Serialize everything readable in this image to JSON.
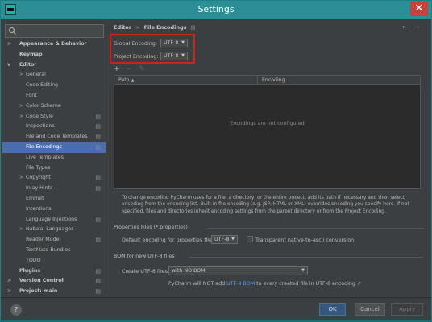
{
  "window": {
    "title": "Settings",
    "close_glyph": "✕"
  },
  "sidebar": {
    "search_placeholder": "",
    "items": [
      {
        "label": "Appearance & Behavior",
        "arrow": ">",
        "bold": true
      },
      {
        "label": "Keymap",
        "arrow": "",
        "bold": true
      },
      {
        "label": "Editor",
        "arrow": "v",
        "bold": true
      },
      {
        "label": "General",
        "arrow": ">"
      },
      {
        "label": "Code Editing"
      },
      {
        "label": "Font"
      },
      {
        "label": "Color Scheme",
        "arrow": ">"
      },
      {
        "label": "Code Style",
        "arrow": ">",
        "glyph": "▤"
      },
      {
        "label": "Inspections",
        "glyph": "▤"
      },
      {
        "label": "File and Code Templates",
        "glyph": "▤"
      },
      {
        "label": "File Encodings",
        "glyph": "▤",
        "selected": true
      },
      {
        "label": "Live Templates"
      },
      {
        "label": "File Types"
      },
      {
        "label": "Copyright",
        "arrow": ">",
        "glyph": "▤"
      },
      {
        "label": "Inlay Hints",
        "glyph": "▤"
      },
      {
        "label": "Emmet"
      },
      {
        "label": "Intentions"
      },
      {
        "label": "Language Injections",
        "glyph": "▤"
      },
      {
        "label": "Natural Languages",
        "arrow": ">"
      },
      {
        "label": "Reader Mode",
        "glyph": "▤"
      },
      {
        "label": "TextMate Bundles"
      },
      {
        "label": "TODO"
      },
      {
        "label": "Plugins",
        "bold": true,
        "glyph": "▤"
      },
      {
        "label": "Version Control",
        "arrow": ">",
        "bold": true,
        "glyph": "▤"
      },
      {
        "label": "Project: main",
        "arrow": ">",
        "bold": true,
        "glyph": "▤"
      }
    ]
  },
  "main": {
    "breadcrumb_parent": "Editor",
    "breadcrumb_sep": ">",
    "breadcrumb_current": "File Encodings",
    "breadcrumb_hint": "▤",
    "back_arrow": "←",
    "forward_arrow": "→",
    "global_encoding_label": "Global Encoding:",
    "global_encoding_value": "UTF-8",
    "project_encoding_label": "Project Encoding:",
    "project_encoding_value": "UTF-8",
    "dropdown_glyph": "▼",
    "toolbar": {
      "add": "+",
      "remove": "−",
      "edit": "✎"
    },
    "table": {
      "col_path": "Path",
      "col_path_sort": "▲",
      "col_encoding": "Encoding",
      "empty_text": "Encodings are not configured"
    },
    "description": "To change encoding PyCharm uses for a file, a directory, or the entire project, add its path if necessary and then select encoding from the encoding list. Built-in file encoding (e.g. JSP, HTML or XML) overrides encoding you specify here. If not specified, files and directories inherit encoding settings from the parent directory or from the Project Encoding.",
    "properties_section": "Properties Files (*.properties)",
    "default_encoding_label": "Default encoding for properties files:",
    "default_encoding_value": "UTF-8",
    "transparent_label": "Transparent native-to-ascii conversion",
    "bom_section": "BOM for new UTF-8 files",
    "create_utf8_label": "Create UTF-8 files:",
    "create_utf8_value": "with NO BOM",
    "bom_note_prefix": "PyCharm will NOT add",
    "bom_note_link": "UTF-8 BOM",
    "bom_note_suffix": "to every created file in UTF-8 encoding ↗"
  },
  "footer": {
    "help": "?",
    "ok": "OK",
    "cancel": "Cancel",
    "apply": "Apply"
  }
}
